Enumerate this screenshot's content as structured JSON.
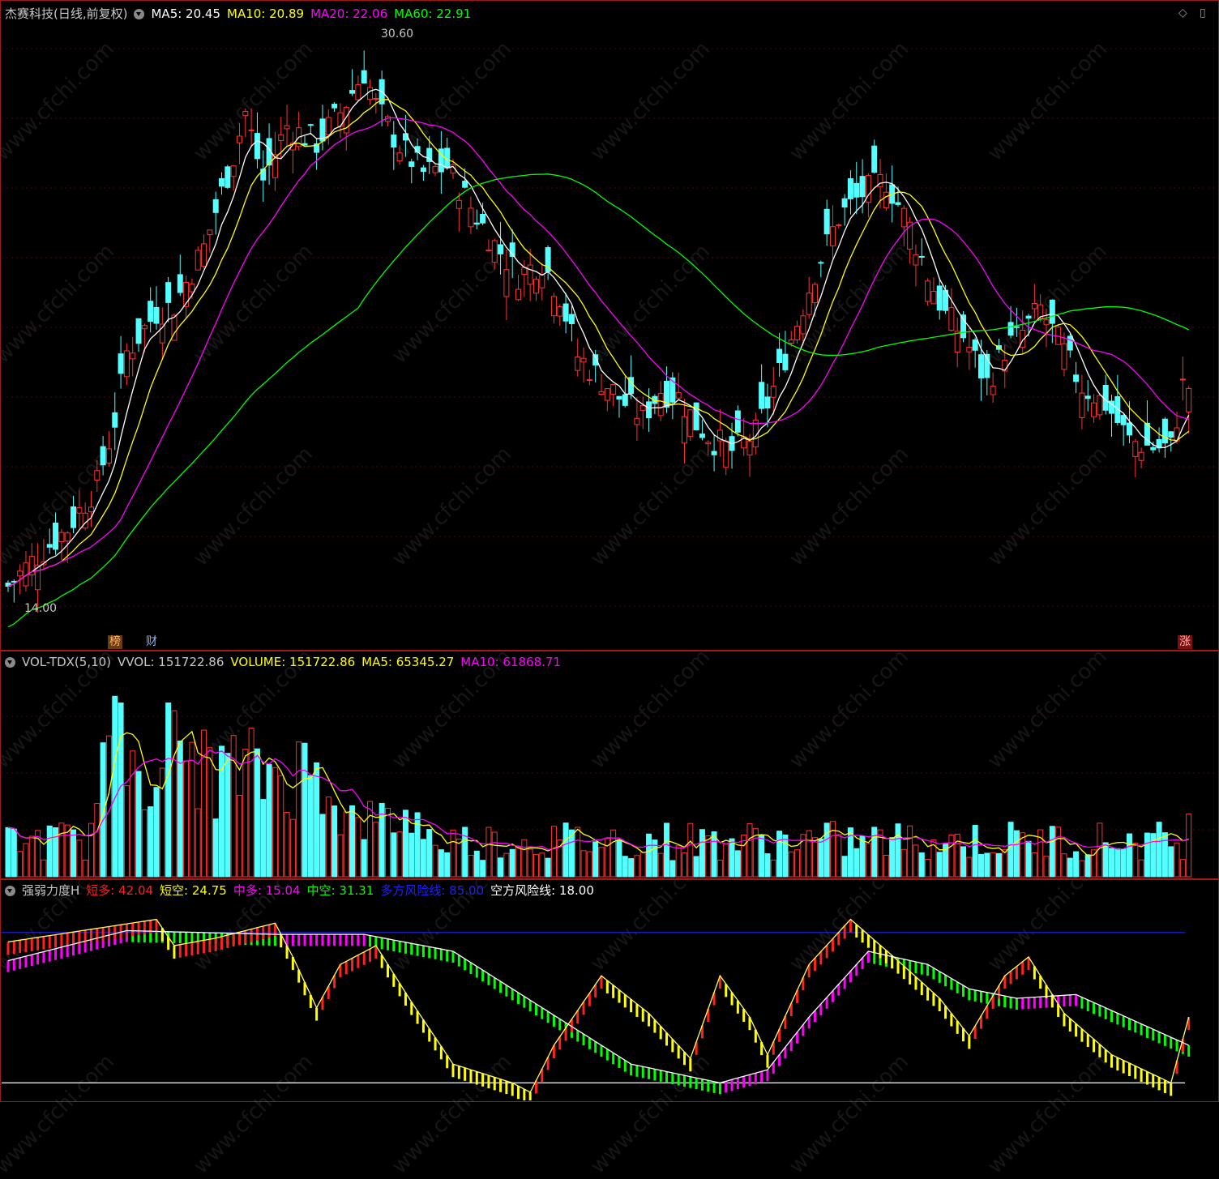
{
  "main": {
    "title": "杰赛科技(日线,前复权)",
    "ma_labels": [
      {
        "text": "MA5: 20.45",
        "color": "#ffffff"
      },
      {
        "text": "MA10: 20.89",
        "color": "#ffff00"
      },
      {
        "text": "MA20: 22.06",
        "color": "#ff00ff"
      },
      {
        "text": "MA60: 22.91",
        "color": "#00ff00"
      }
    ],
    "high_label": "30.60",
    "low_label": "14.00",
    "tags": {
      "bang": "榜",
      "cai": "财",
      "zhang": "涨"
    }
  },
  "volume": {
    "title": "VOL-TDX(5,10)",
    "labels": [
      {
        "text": "VVOL: 151722.86",
        "color": "#c8c8c8"
      },
      {
        "text": "VOLUME: 151722.86",
        "color": "#ffff00"
      },
      {
        "text": "MA5: 65345.27",
        "color": "#ffff00"
      },
      {
        "text": "MA10: 61868.71",
        "color": "#ff00ff"
      }
    ]
  },
  "indicator": {
    "title": "强弱力度H",
    "labels": [
      {
        "text": "短多: 42.04",
        "color": "#ff2020"
      },
      {
        "text": "短空: 24.75",
        "color": "#ffff00"
      },
      {
        "text": "中多: 15.04",
        "color": "#ff00ff"
      },
      {
        "text": "中空: 31.31",
        "color": "#00ff00"
      },
      {
        "text": "多方风险线: 85.00",
        "color": "#2020ff"
      },
      {
        "text": "空方风险线: 18.00",
        "color": "#ffffff"
      }
    ]
  },
  "watermark": "www.cfchi.com",
  "colors": {
    "up": "#ff3232",
    "down": "#54ffff",
    "frame": "#a01818",
    "ma5": "#ffffff",
    "ma10": "#ffff00",
    "ma20": "#ff00ff",
    "ma60": "#00ff00"
  },
  "icons": [
    "toggle-circle-icon",
    "diamond-icon",
    "square-icon"
  ]
}
